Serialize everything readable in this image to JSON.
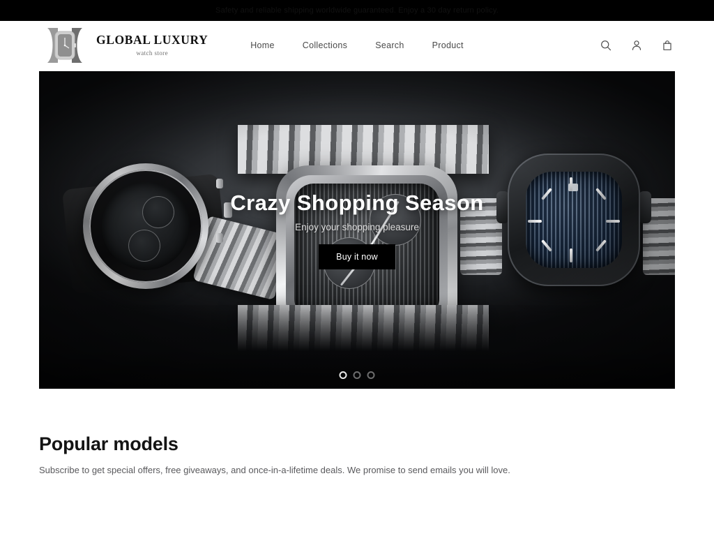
{
  "announcement": {
    "text": "Safety and reliable shipping worldwide guaranteed. Enjoy a 30 day return policy."
  },
  "header": {
    "brand": {
      "title": "GLOBAL LUXURY",
      "subtitle": "watch store",
      "mark_icon": "square-watch-icon"
    },
    "nav": [
      {
        "label": "Home"
      },
      {
        "label": "Collections"
      },
      {
        "label": "Search"
      },
      {
        "label": "Product"
      }
    ],
    "actions": [
      {
        "icon": "search-icon",
        "label": "Search"
      },
      {
        "icon": "account-icon",
        "label": "Account"
      },
      {
        "icon": "cart-bag-icon",
        "label": "Cart"
      }
    ]
  },
  "hero": {
    "title": "Crazy Shopping Season",
    "subtitle": "Enjoy your shopping pleasure",
    "cta_label": "Buy it now",
    "slides": [
      {
        "index": 1,
        "active": true
      },
      {
        "index": 2,
        "active": false
      },
      {
        "index": 3,
        "active": false
      }
    ]
  },
  "popular": {
    "title": "Popular models",
    "subtitle": "Subscribe to get special offers, free giveaways, and once-in-a-lifetime deals. We promise to send emails you will love."
  },
  "colors": {
    "announcement_bg": "#000000",
    "page_bg": "#ffffff",
    "text_primary": "#141414",
    "text_muted": "#59595c",
    "cta_bg": "#000000",
    "cta_text": "#ffffff"
  }
}
